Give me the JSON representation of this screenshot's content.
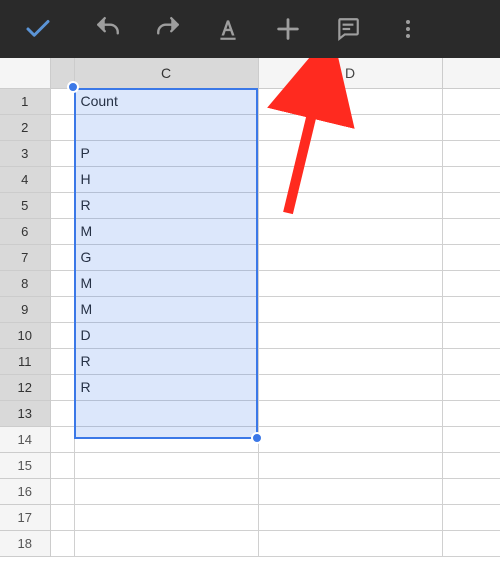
{
  "toolbar": {
    "confirm_icon": "check-icon",
    "undo_icon": "undo-icon",
    "redo_icon": "redo-icon",
    "format_icon": "text-format-icon",
    "insert_icon": "plus-icon",
    "comment_icon": "comment-icon",
    "overflow_icon": "more-vert-icon"
  },
  "columns": {
    "left_partial": "",
    "C": "C",
    "D": "D",
    "E_partial": ""
  },
  "rows": [
    "1",
    "2",
    "3",
    "4",
    "5",
    "6",
    "7",
    "8",
    "9",
    "10",
    "11",
    "12",
    "13",
    "14",
    "15",
    "16",
    "17",
    "18"
  ],
  "selected_columns": [
    "C"
  ],
  "selected_rows": [
    "1",
    "2",
    "3",
    "4",
    "5",
    "6",
    "7",
    "8",
    "9",
    "10",
    "11",
    "12",
    "13"
  ],
  "cells": {
    "C": {
      "1": "Count",
      "2": "",
      "3": "P",
      "4": "H",
      "5": "R",
      "6": "M",
      "7": "G",
      "8": "M",
      "9": "M",
      "10": "D",
      "11": "R",
      "12": "R",
      "13": ""
    }
  },
  "annotation": {
    "kind": "arrow",
    "color": "#ff2a1f",
    "points_to": "toolbar.insert_icon"
  }
}
